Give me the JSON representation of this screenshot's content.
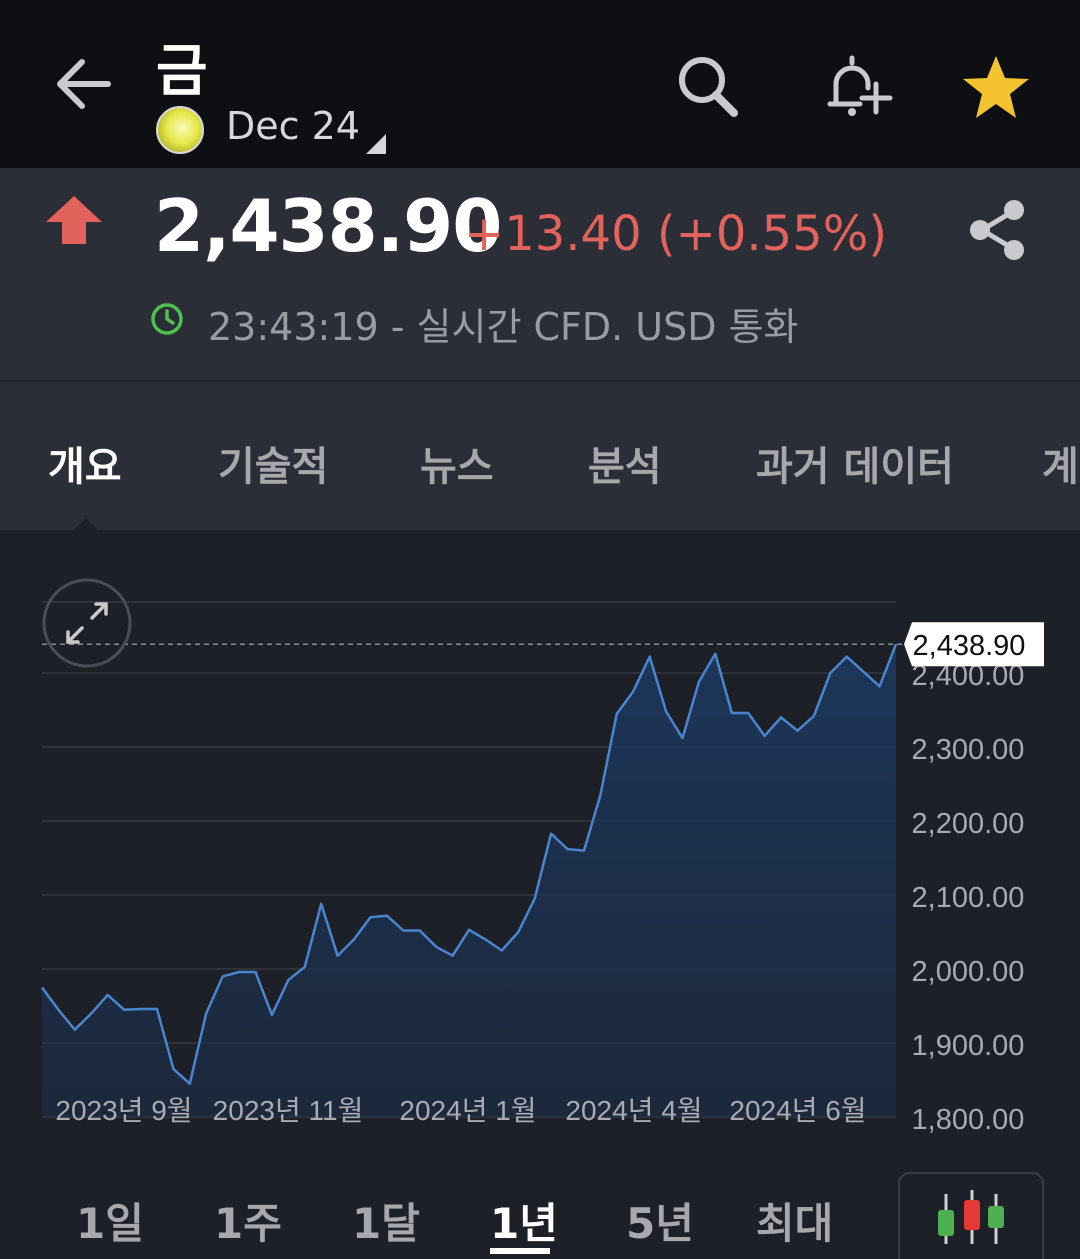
{
  "header": {
    "title": "금",
    "contract": "Dec 24"
  },
  "quote": {
    "price": "2,438.90",
    "change": "+13.40 (+0.55%)",
    "meta": "23:43:19 - 실시간 CFD. USD 통화",
    "direction": "up",
    "up_color": "#e2625c"
  },
  "tabs": [
    {
      "label": "개요",
      "active": true
    },
    {
      "label": "기술적",
      "active": false
    },
    {
      "label": "뉴스",
      "active": false
    },
    {
      "label": "분석",
      "active": false
    },
    {
      "label": "과거 데이터",
      "active": false
    },
    {
      "label": "계",
      "active": false
    }
  ],
  "ranges": [
    {
      "label": "1일",
      "active": false
    },
    {
      "label": "1주",
      "active": false
    },
    {
      "label": "1달",
      "active": false
    },
    {
      "label": "1년",
      "active": true
    },
    {
      "label": "5년",
      "active": false
    },
    {
      "label": "최대",
      "active": false
    }
  ],
  "chart_data": {
    "type": "area",
    "y_ticks": [
      "2,400.00",
      "2,300.00",
      "2,200.00",
      "2,100.00",
      "2,000.00",
      "1,900.00",
      "1,800.00"
    ],
    "x_ticks": [
      "2023년 9월",
      "2023년 11월",
      "2024년 1월",
      "2024년 4월",
      "2024년 6월"
    ],
    "ylim": [
      1800,
      2500
    ],
    "current_value": 2438.9,
    "current_label": "2,438.90",
    "line_color": "#4a86d0",
    "values": [
      1975,
      1945,
      1918,
      1940,
      1965,
      1945,
      1946,
      1946,
      1865,
      1845,
      1940,
      1990,
      1996,
      1996,
      1938,
      1985,
      2003,
      2088,
      2018,
      2040,
      2070,
      2072,
      2052,
      2052,
      2030,
      2018,
      2053,
      2040,
      2025,
      2050,
      2095,
      2183,
      2162,
      2160,
      2235,
      2345,
      2375,
      2422,
      2348,
      2312,
      2388,
      2426,
      2346,
      2346,
      2315,
      2340,
      2322,
      2342,
      2400,
      2422,
      2402,
      2382,
      2438.9
    ]
  }
}
